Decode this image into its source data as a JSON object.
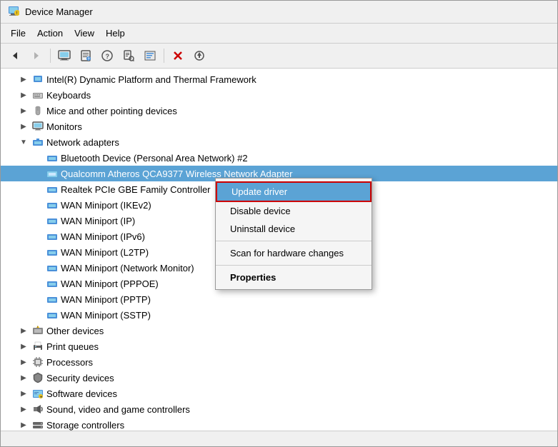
{
  "window": {
    "title": "Device Manager",
    "title_icon": "device-manager-icon"
  },
  "menubar": {
    "items": [
      {
        "label": "File",
        "id": "menu-file"
      },
      {
        "label": "Action",
        "id": "menu-action"
      },
      {
        "label": "View",
        "id": "menu-view"
      },
      {
        "label": "Help",
        "id": "menu-help"
      }
    ]
  },
  "toolbar": {
    "buttons": [
      {
        "id": "back",
        "icon": "←",
        "label": "Back"
      },
      {
        "id": "forward",
        "icon": "→",
        "label": "Forward"
      },
      {
        "id": "computer",
        "icon": "🖥",
        "label": "Computer"
      },
      {
        "id": "properties",
        "icon": "📋",
        "label": "Properties"
      },
      {
        "id": "help",
        "icon": "?",
        "label": "Help"
      },
      {
        "id": "scan",
        "icon": "🔍",
        "label": "Scan"
      },
      {
        "id": "resources",
        "icon": "📊",
        "label": "Resources"
      },
      {
        "id": "remove",
        "icon": "✕",
        "label": "Remove"
      },
      {
        "id": "update",
        "icon": "⬇",
        "label": "Update"
      }
    ]
  },
  "tree": {
    "items": [
      {
        "id": "intel-dynamic",
        "label": "Intel(R) Dynamic Platform and Thermal Framework",
        "indent": 1,
        "expanded": false,
        "icon": "device",
        "has_expand": true
      },
      {
        "id": "keyboards",
        "label": "Keyboards",
        "indent": 1,
        "expanded": false,
        "icon": "keyboard",
        "has_expand": true
      },
      {
        "id": "mice",
        "label": "Mice and other pointing devices",
        "indent": 1,
        "expanded": false,
        "icon": "mouse",
        "has_expand": true
      },
      {
        "id": "monitors",
        "label": "Monitors",
        "indent": 1,
        "expanded": false,
        "icon": "monitor",
        "has_expand": true
      },
      {
        "id": "network-adapters",
        "label": "Network adapters",
        "indent": 1,
        "expanded": true,
        "icon": "network",
        "has_expand": true
      },
      {
        "id": "bluetooth",
        "label": "Bluetooth Device (Personal Area Network) #2",
        "indent": 2,
        "expanded": false,
        "icon": "network",
        "has_expand": false
      },
      {
        "id": "qualcomm",
        "label": "Qualcomm Atheros QCA9377 Wireless Network Adapter",
        "indent": 2,
        "expanded": false,
        "icon": "network",
        "has_expand": false,
        "selected": true
      },
      {
        "id": "realtek",
        "label": "Realtek PCIe GBE Family Controller",
        "indent": 2,
        "expanded": false,
        "icon": "network",
        "has_expand": false
      },
      {
        "id": "wan-ikev2",
        "label": "WAN Miniport (IKEv2)",
        "indent": 2,
        "expanded": false,
        "icon": "network",
        "has_expand": false
      },
      {
        "id": "wan-ip",
        "label": "WAN Miniport (IP)",
        "indent": 2,
        "expanded": false,
        "icon": "network",
        "has_expand": false
      },
      {
        "id": "wan-ipv6",
        "label": "WAN Miniport (IPv6)",
        "indent": 2,
        "expanded": false,
        "icon": "network",
        "has_expand": false
      },
      {
        "id": "wan-l2tp",
        "label": "WAN Miniport (L2TP)",
        "indent": 2,
        "expanded": false,
        "icon": "network",
        "has_expand": false
      },
      {
        "id": "wan-network-monitor",
        "label": "WAN Miniport (Network Monitor)",
        "indent": 2,
        "expanded": false,
        "icon": "network",
        "has_expand": false
      },
      {
        "id": "wan-pppoe",
        "label": "WAN Miniport (PPPOE)",
        "indent": 2,
        "expanded": false,
        "icon": "network",
        "has_expand": false
      },
      {
        "id": "wan-pptp",
        "label": "WAN Miniport (PPTP)",
        "indent": 2,
        "expanded": false,
        "icon": "network",
        "has_expand": false
      },
      {
        "id": "wan-sstp",
        "label": "WAN Miniport (SSTP)",
        "indent": 2,
        "expanded": false,
        "icon": "network",
        "has_expand": false
      },
      {
        "id": "other-devices",
        "label": "Other devices",
        "indent": 1,
        "expanded": false,
        "icon": "warning",
        "has_expand": true
      },
      {
        "id": "print-queues",
        "label": "Print queues",
        "indent": 1,
        "expanded": false,
        "icon": "printer",
        "has_expand": true
      },
      {
        "id": "processors",
        "label": "Processors",
        "indent": 1,
        "expanded": false,
        "icon": "processor",
        "has_expand": true
      },
      {
        "id": "security-devices",
        "label": "Security devices",
        "indent": 1,
        "expanded": false,
        "icon": "security",
        "has_expand": true
      },
      {
        "id": "software-devices",
        "label": "Software devices",
        "indent": 1,
        "expanded": false,
        "icon": "software",
        "has_expand": true
      },
      {
        "id": "sound",
        "label": "Sound, video and game controllers",
        "indent": 1,
        "expanded": false,
        "icon": "sound",
        "has_expand": true
      },
      {
        "id": "storage",
        "label": "Storage controllers",
        "indent": 1,
        "expanded": false,
        "icon": "storage",
        "has_expand": true
      }
    ]
  },
  "context_menu": {
    "items": [
      {
        "id": "update-driver",
        "label": "Update driver",
        "highlighted": true,
        "bold": false
      },
      {
        "id": "disable-device",
        "label": "Disable device",
        "highlighted": false,
        "bold": false
      },
      {
        "id": "uninstall-device",
        "label": "Uninstall device",
        "highlighted": false,
        "bold": false
      },
      {
        "id": "separator",
        "type": "separator"
      },
      {
        "id": "scan-hardware",
        "label": "Scan for hardware changes",
        "highlighted": false,
        "bold": false
      },
      {
        "id": "separator2",
        "type": "separator"
      },
      {
        "id": "properties",
        "label": "Properties",
        "highlighted": false,
        "bold": true
      }
    ]
  },
  "statusbar": {
    "text": ""
  }
}
